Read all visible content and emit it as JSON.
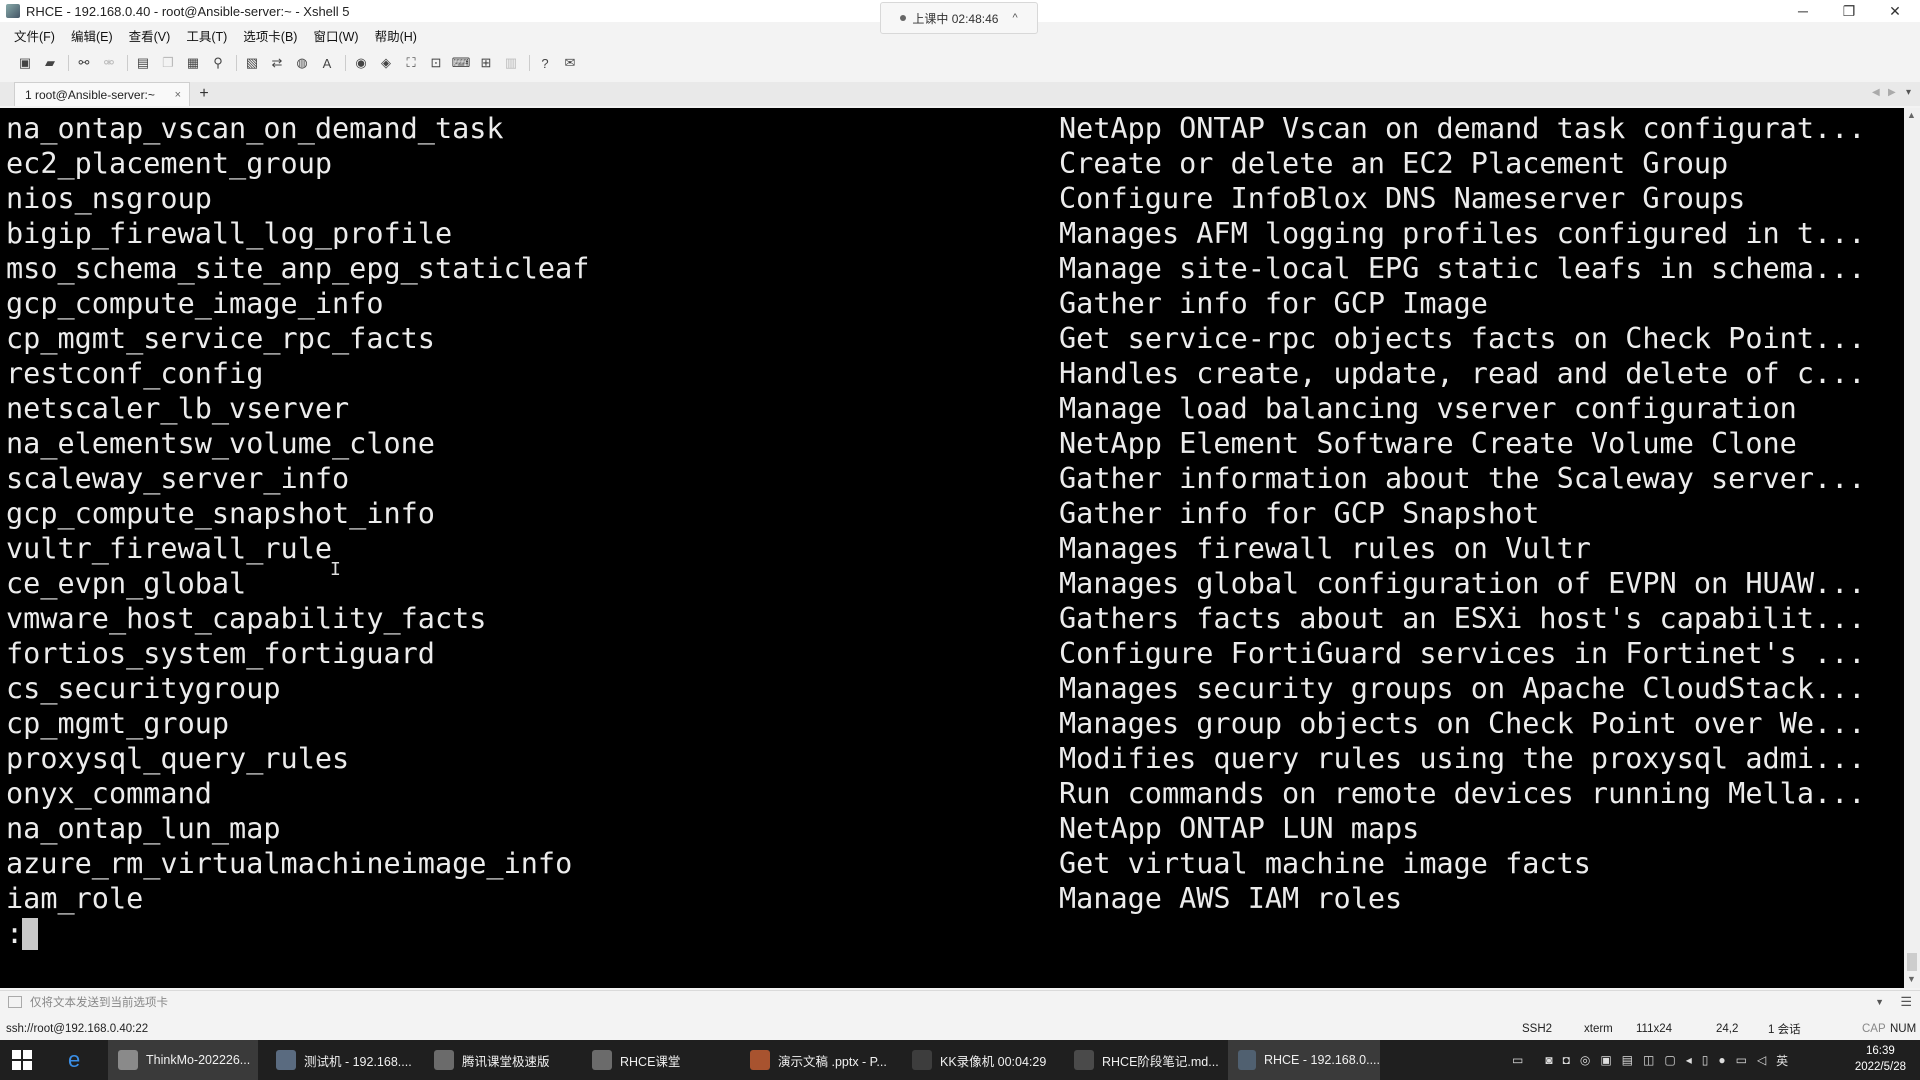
{
  "window": {
    "title": "RHCE - 192.168.0.40 - root@Ansible-server:~ - Xshell 5",
    "minimize": "─",
    "restore": "❐",
    "close": "✕"
  },
  "recording": {
    "label": "上课中 02:48:46",
    "chevron": "^"
  },
  "menu": [
    "文件(F)",
    "编辑(E)",
    "查看(V)",
    "工具(T)",
    "选项卡(B)",
    "窗口(W)",
    "帮助(H)"
  ],
  "tab": {
    "label": "1 root@Ansible-server:~",
    "close": "×",
    "add": "+"
  },
  "terminal": {
    "lines": [
      {
        "name": "na_ontap_vscan_on_demand_task",
        "desc": "NetApp ONTAP Vscan on demand task configurat..."
      },
      {
        "name": "ec2_placement_group",
        "desc": "Create or delete an EC2 Placement Group"
      },
      {
        "name": "nios_nsgroup",
        "desc": "Configure InfoBlox DNS Nameserver Groups"
      },
      {
        "name": "bigip_firewall_log_profile",
        "desc": "Manages AFM logging profiles configured in t..."
      },
      {
        "name": "mso_schema_site_anp_epg_staticleaf",
        "desc": "Manage site-local EPG static leafs in schema..."
      },
      {
        "name": "gcp_compute_image_info",
        "desc": "Gather info for GCP Image"
      },
      {
        "name": "cp_mgmt_service_rpc_facts",
        "desc": "Get service-rpc objects facts on Check Point..."
      },
      {
        "name": "restconf_config",
        "desc": "Handles create, update, read and delete of c..."
      },
      {
        "name": "netscaler_lb_vserver",
        "desc": "Manage load balancing vserver configuration"
      },
      {
        "name": "na_elementsw_volume_clone",
        "desc": "NetApp Element Software Create Volume Clone"
      },
      {
        "name": "scaleway_server_info",
        "desc": "Gather information about the Scaleway server..."
      },
      {
        "name": "gcp_compute_snapshot_info",
        "desc": "Gather info for GCP Snapshot"
      },
      {
        "name": "vultr_firewall_rule",
        "desc": "Manages firewall rules on Vultr"
      },
      {
        "name": "ce_evpn_global",
        "desc": "Manages global configuration of EVPN on HUAW..."
      },
      {
        "name": "vmware_host_capability_facts",
        "desc": "Gathers facts about an ESXi host's capabilit..."
      },
      {
        "name": "fortios_system_fortiguard",
        "desc": "Configure FortiGuard services in Fortinet's ..."
      },
      {
        "name": "cs_securitygroup",
        "desc": "Manages security groups on Apache CloudStack..."
      },
      {
        "name": "cp_mgmt_group",
        "desc": "Manages group objects on Check Point over We..."
      },
      {
        "name": "proxysql_query_rules",
        "desc": "Modifies query rules using the proxysql admi..."
      },
      {
        "name": "onyx_command",
        "desc": "Run commands on remote devices running Mella..."
      },
      {
        "name": "na_ontap_lun_map",
        "desc": "NetApp ONTAP LUN maps"
      },
      {
        "name": "azure_rm_virtualmachineimage_info",
        "desc": "Get virtual machine image facts"
      },
      {
        "name": "iam_role",
        "desc": "Manage AWS IAM roles"
      }
    ],
    "prompt": ":"
  },
  "compose": {
    "placeholder": "仅将文本发送到当前选项卡"
  },
  "status": {
    "connection": "ssh://root@192.168.0.40:22",
    "protocol": "SSH2",
    "term": "xterm",
    "size": "111x24",
    "cursor": "24,2",
    "sessions": "1 会话",
    "cap": "CAP",
    "num": "NUM"
  },
  "taskbar": {
    "items": [
      {
        "label": "ThinkMo-202226...",
        "color": "#8a8a8a",
        "active": true
      },
      {
        "label": "测试机 - 192.168....",
        "color": "#5a6b80",
        "active": false
      },
      {
        "label": "腾讯课堂极速版",
        "color": "#6b6b6b",
        "active": false
      },
      {
        "label": "RHCE课堂",
        "color": "#6b6b6b",
        "active": false
      },
      {
        "label": "演示文稿 .pptx - P...",
        "color": "#a8532f",
        "active": false
      },
      {
        "label": "KK录像机 00:04:29",
        "color": "#3d3d3d",
        "active": false
      },
      {
        "label": "RHCE阶段笔记.md...",
        "color": "#4a4a4a",
        "active": false
      },
      {
        "label": "RHCE - 192.168.0....",
        "color": "#506070",
        "active": true
      }
    ],
    "ime": "英",
    "time": "16:39",
    "date": "2022/5/28"
  }
}
